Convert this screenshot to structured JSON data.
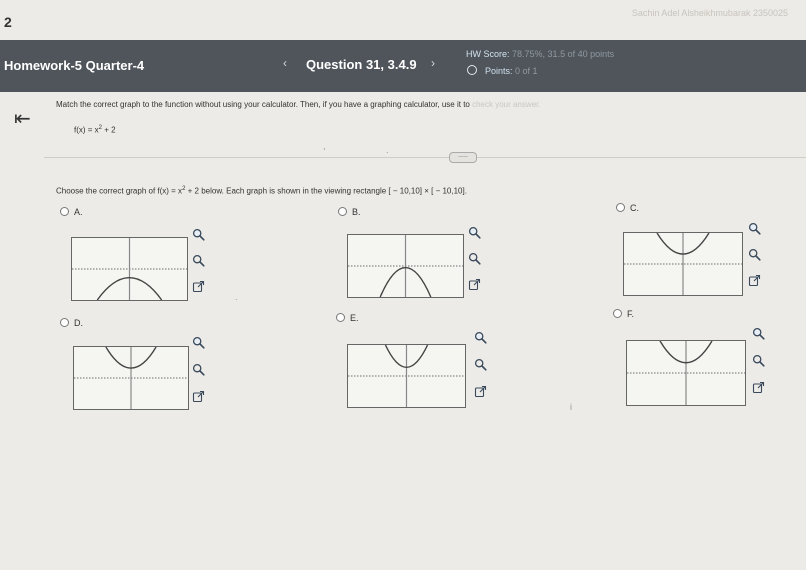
{
  "page": {
    "number": "2",
    "user_line": "Sachin Adel Alsheikhmubarak 2350025"
  },
  "header": {
    "title": "Homework-5 Quarter-4",
    "question_label": "Question 31, 3.4.9",
    "prev_icon": "chevron-left-icon",
    "next_icon": "chevron-right-icon",
    "hw_score_prefix": "HW Score:",
    "hw_score_value": "78.75%, 31.5 of 40 points",
    "points_prefix": "Points:",
    "points_value": "0 of 1"
  },
  "question": {
    "instructions_main": "Match the correct graph to the function without using your calculator. Then, if you have a graphing calculator, use it to",
    "instructions_faded": "check your answer.",
    "function_text": "f(x) = x",
    "function_exp": "2",
    "function_tail": " + 2",
    "expand_label": "....."
  },
  "prompt": {
    "before": "Choose the correct graph of f(x) = x",
    "exp": "2",
    "after": " + 2 below. Each graph is shown in the viewing rectangle [ − 10,10] × [ − 10,10]."
  },
  "options": [
    {
      "label": "A.",
      "shape": "down-lower"
    },
    {
      "label": "B.",
      "shape": "down-low"
    },
    {
      "label": "C.",
      "shape": "up-upper"
    },
    {
      "label": "D.",
      "shape": "up-upper"
    },
    {
      "label": "E.",
      "shape": "up-wide"
    },
    {
      "label": "F.",
      "shape": "up-upper"
    }
  ],
  "tool_icons": [
    "zoom-in-icon",
    "zoom-out-icon",
    "external-link-icon"
  ],
  "colors": {
    "header_bg": "#50555b",
    "page_bg": "#ecebe7",
    "axis": "#888888",
    "curve": "#444444"
  }
}
